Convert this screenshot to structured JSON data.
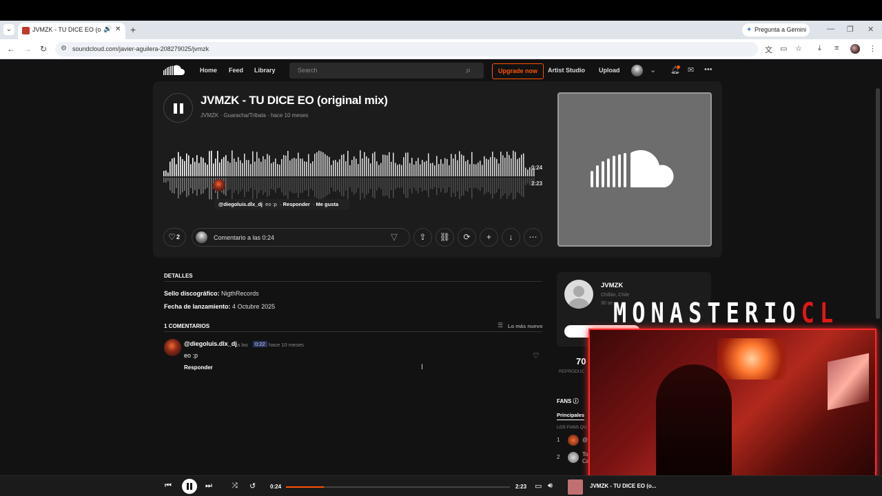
{
  "browser": {
    "tab_title": "JVMZK - TU DICE EO (origin",
    "tab_close": "✕",
    "new_tab": "+",
    "gemini_label": "Pregunta a Gemini",
    "url": "soundcloud.com/javier-aguilera-208279025/jvmzk"
  },
  "header": {
    "nav": [
      "Home",
      "Feed",
      "Library"
    ],
    "search_placeholder": "Search",
    "upgrade_label": "Upgrade now",
    "artist_studio": "Artist Studio",
    "upload": "Upload"
  },
  "track": {
    "title": "JVMZK - TU DICE EO (original mix)",
    "meta": "JVMZK · Guaracha/Tribala · hace 10 meses",
    "time_elapsed": "0:24",
    "time_total": "2:23",
    "progress": 0.168,
    "like_count": "2",
    "comment_placeholder": "Comentario a las 0:24"
  },
  "waveform_popup": {
    "user": "@diegoluis.dlx_dj",
    "text": "eo :p",
    "reply": "Responder",
    "like": "Me gusta"
  },
  "details": {
    "heading": "DETALLES",
    "label_key": "Sello discográfico:",
    "label_value": "NigthRecords",
    "release_key": "Fecha de lanzamiento:",
    "release_value": "4 Octubre 2025"
  },
  "comments": {
    "heading": "1 COMENTARIOS",
    "sort": "Lo más nuevo",
    "items": [
      {
        "user": "@diegoluis.dlx_dj",
        "at": "a las",
        "time": "0:22",
        "ago": "hace 10 meses",
        "body": "eo :p",
        "reply": "Responder"
      }
    ]
  },
  "sidebar": {
    "artist_name": "JVMZK",
    "artist_location": "Chillán, Chile",
    "artist_sub": "30 se",
    "stat_value": "70",
    "stat_label": "REPRODUC",
    "fans_heading": "FANS",
    "fans_tab": "Principales",
    "fans_sub": "LOS FANS QU",
    "fans": [
      {
        "rank": "1",
        "name": "@"
      },
      {
        "rank": "2",
        "name": "To"
      }
    ],
    "fan2_line2": "Ca"
  },
  "overlay": {
    "title_white": "MONASTERIO",
    "title_red": "CL"
  },
  "player": {
    "time_elapsed": "0:24",
    "time_total": "2:23",
    "track_title": "JVMZK - TU DICE EO (o..."
  },
  "colors": {
    "accent": "#ff5500",
    "background": "#121212",
    "panel": "#1c1c1c"
  }
}
